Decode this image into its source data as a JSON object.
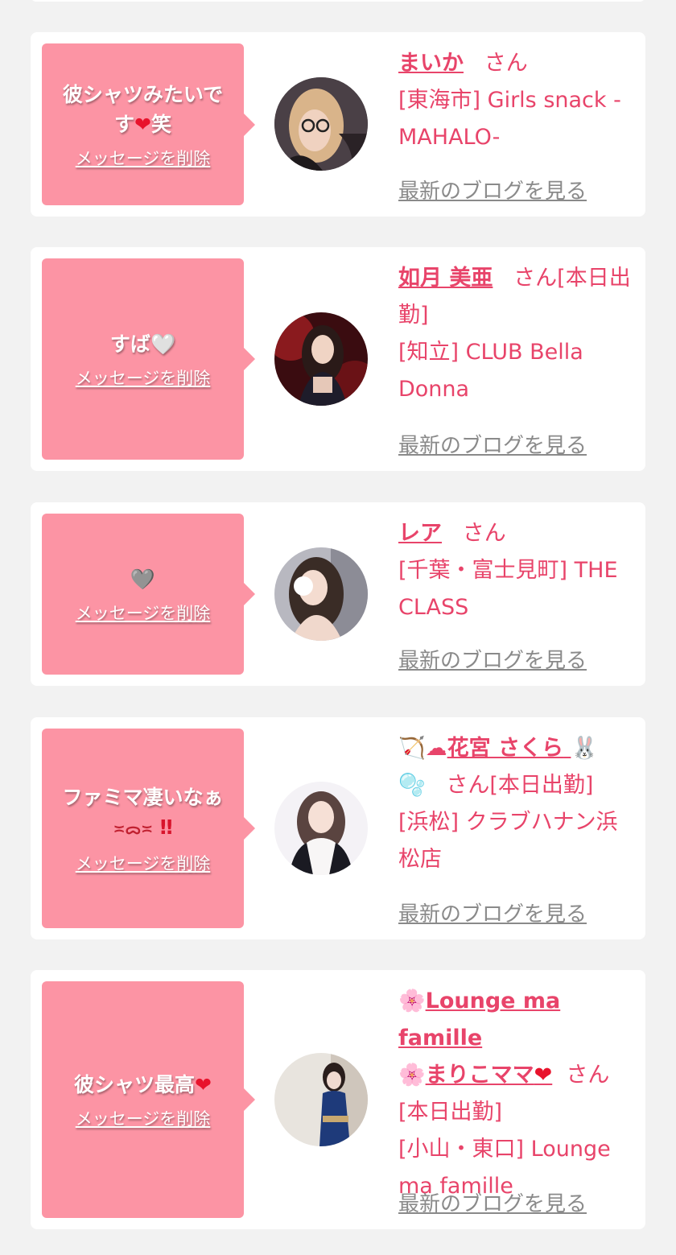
{
  "common": {
    "delete_label": "メッセージを削除",
    "blog_label": "最新のブログを見る"
  },
  "cards": [
    {
      "message_pre": "彼シャツみたいです",
      "message_heart": "❤",
      "message_post": "笑",
      "name": "まいか",
      "san": "さん",
      "store": "[東海市] Girls snack -MAHALO-"
    },
    {
      "message_pre": "すば",
      "message_heart": "🤍",
      "name": "如月 美亜",
      "san": "さん[本日出勤]",
      "store": "[知立] CLUB Bella Donna"
    },
    {
      "message_heart": "🩶",
      "name": "レア",
      "san": "さん",
      "store": "[千葉・富士見町] THE CLASS"
    },
    {
      "message_pre": "ファミマ凄いなぁ",
      "message_face": "≍ᯅ≍",
      "message_bang": "‼",
      "name_prefix_icons": "🏹☁",
      "name": "花宮 さくら",
      "name_suffix_icon": "🐰",
      "bubbles_icon": "🫧",
      "san": "さん[本日出勤]",
      "store": "[浜松] クラブハナン浜松店"
    },
    {
      "message_pre": "彼シャツ最高",
      "message_heart": "❤",
      "name_icon_1": "🌸",
      "name_part_1": "Lounge ma famille",
      "name_icon_2": "🌸",
      "name_part_2": "まりこママ",
      "name_heart": "❤",
      "san": "さん[本日出勤]",
      "store": "[小山・東口] Lounge ma famille"
    }
  ],
  "colors": {
    "bubble": "#fc94a4",
    "accent_text": "#e8446a",
    "link_gray": "#8a8a8a",
    "background": "#f2f2f2"
  }
}
